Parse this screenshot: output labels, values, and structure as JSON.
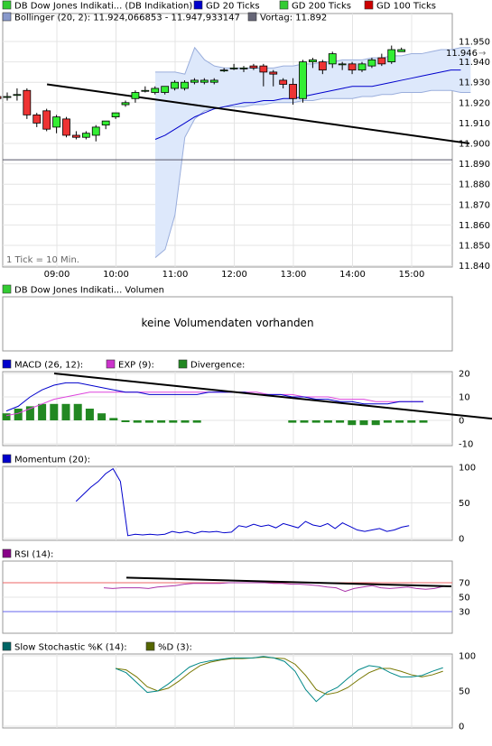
{
  "price_legend": [
    {
      "label": "DB Dow Jones Indikati... (DB Indikation)",
      "color": "#33cc33"
    },
    {
      "label": "GD 20 Ticks",
      "color": "#0000cc"
    },
    {
      "label": "GD 200 Ticks",
      "color": "#33cc33"
    },
    {
      "label": "GD 100 Ticks",
      "color": "#cc0000"
    },
    {
      "label": "Bollinger (20, 2): 11.924,066853 - 11.947,933147",
      "color": "#8899cc"
    },
    {
      "label": "Vortag: 11.892",
      "color": "#666677"
    }
  ],
  "tick_note": "1 Tick = 10 Min.",
  "last_price_label": "11.946",
  "volume": {
    "label": "DB Dow Jones Indikati... Volumen",
    "message": "keine Volumendaten vorhanden"
  },
  "macd_legend": [
    {
      "label": "MACD (26, 12):",
      "color": "#0000cc"
    },
    {
      "label": "EXP (9):",
      "color": "#cc33cc"
    },
    {
      "label": "Divergence:",
      "color": "#228822"
    }
  ],
  "momentum_legend": [
    {
      "label": "Momentum (20):",
      "color": "#0000cc"
    }
  ],
  "rsi_legend": [
    {
      "label": "RSI (14):",
      "color": "#880088"
    }
  ],
  "stoch_legend": [
    {
      "label": "Slow Stochastic %K (14):",
      "color": "#006666"
    },
    {
      "label": "%D (3):",
      "color": "#556600"
    }
  ],
  "chart_data": [
    {
      "type": "candlestick",
      "x_labels": [
        "09:00",
        "10:00",
        "11:00",
        "12:00",
        "13:00",
        "14:00",
        "15:00"
      ],
      "ylim": [
        11835,
        11955
      ],
      "yticks": [
        "11.840",
        "11.850",
        "11.860",
        "11.870",
        "11.880",
        "11.890",
        "11.900",
        "11.910",
        "11.920",
        "11.930",
        "11.940",
        "11.950"
      ],
      "reference_line": 11892,
      "candles": [
        {
          "t": "08:30",
          "o": 11921,
          "h": 11925,
          "l": 11917,
          "c": 11924
        },
        {
          "t": "08:40",
          "o": 11924,
          "h": 11925,
          "l": 11922,
          "c": 11923
        },
        {
          "t": "08:50",
          "o": 11923,
          "h": 11924,
          "l": 11921,
          "c": 11922
        },
        {
          "t": "09:00",
          "o": 11923,
          "h": 11925,
          "l": 11921,
          "c": 11923
        },
        {
          "t": "09:10",
          "o": 11924,
          "h": 11927,
          "l": 11921,
          "c": 11924
        },
        {
          "t": "09:20",
          "o": 11926,
          "h": 11927,
          "l": 11912,
          "c": 11914
        },
        {
          "t": "09:30",
          "o": 11914,
          "h": 11915,
          "l": 11908,
          "c": 11910
        },
        {
          "t": "09:40",
          "o": 11916,
          "h": 11917,
          "l": 11906,
          "c": 11907
        },
        {
          "t": "09:50",
          "o": 11908,
          "h": 11914,
          "l": 11905,
          "c": 11913
        },
        {
          "t": "10:00",
          "o": 11912,
          "h": 11913,
          "l": 11903,
          "c": 11904
        },
        {
          "t": "10:10",
          "o": 11904,
          "h": 11906,
          "l": 11902,
          "c": 11903
        },
        {
          "t": "10:20",
          "o": 11903,
          "h": 11906,
          "l": 11902,
          "c": 11905
        },
        {
          "t": "10:30",
          "o": 11904,
          "h": 11909,
          "l": 11901,
          "c": 11908
        },
        {
          "t": "10:40",
          "o": 11909,
          "h": 11911,
          "l": 11907,
          "c": 11911
        },
        {
          "t": "10:50",
          "o": 11913,
          "h": 11915,
          "l": 11912,
          "c": 11915
        },
        {
          "t": "11:00",
          "o": 11919,
          "h": 11921,
          "l": 11918,
          "c": 11920
        },
        {
          "t": "11:10",
          "o": 11922,
          "h": 11926,
          "l": 11920,
          "c": 11925
        },
        {
          "t": "11:20",
          "o": 11926,
          "h": 11928,
          "l": 11925,
          "c": 11926
        },
        {
          "t": "11:30",
          "o": 11925,
          "h": 11928,
          "l": 11924,
          "c": 11927
        },
        {
          "t": "11:40",
          "o": 11925,
          "h": 11928,
          "l": 11924,
          "c": 11928
        },
        {
          "t": "11:50",
          "o": 11927,
          "h": 11931,
          "l": 11926,
          "c": 11930
        },
        {
          "t": "12:00",
          "o": 11927,
          "h": 11931,
          "l": 11926,
          "c": 11930
        },
        {
          "t": "12:10",
          "o": 11930,
          "h": 11932,
          "l": 11929,
          "c": 11931
        },
        {
          "t": "12:20",
          "o": 11930,
          "h": 11932,
          "l": 11929,
          "c": 11931
        },
        {
          "t": "12:30",
          "o": 11930,
          "h": 11932,
          "l": 11929,
          "c": 11931
        },
        {
          "t": "12:40",
          "o": 11936,
          "h": 11937,
          "l": 11935,
          "c": 11936
        },
        {
          "t": "12:50",
          "o": 11937,
          "h": 11939,
          "l": 11936,
          "c": 11937
        },
        {
          "t": "13:00",
          "o": 11937,
          "h": 11938,
          "l": 11935,
          "c": 11937
        },
        {
          "t": "13:10",
          "o": 11938,
          "h": 11939,
          "l": 11936,
          "c": 11937
        },
        {
          "t": "13:20",
          "o": 11938,
          "h": 11939,
          "l": 11928,
          "c": 11935
        },
        {
          "t": "13:30",
          "o": 11935,
          "h": 11936,
          "l": 11928,
          "c": 11934
        },
        {
          "t": "13:40",
          "o": 11931,
          "h": 11932,
          "l": 11927,
          "c": 11929
        },
        {
          "t": "13:50",
          "o": 11929,
          "h": 11932,
          "l": 11919,
          "c": 11922
        },
        {
          "t": "14:00",
          "o": 11922,
          "h": 11941,
          "l": 11920,
          "c": 11940
        },
        {
          "t": "14:10",
          "o": 11940,
          "h": 11942,
          "l": 11937,
          "c": 11941
        },
        {
          "t": "14:20",
          "o": 11940,
          "h": 11941,
          "l": 11934,
          "c": 11936
        },
        {
          "t": "14:30",
          "o": 11939,
          "h": 11945,
          "l": 11937,
          "c": 11944
        },
        {
          "t": "14:40",
          "o": 11939,
          "h": 11940,
          "l": 11936,
          "c": 11939
        },
        {
          "t": "14:50",
          "o": 11939,
          "h": 11940,
          "l": 11934,
          "c": 11936
        },
        {
          "t": "15:00",
          "o": 11936,
          "h": 11940,
          "l": 11935,
          "c": 11939
        },
        {
          "t": "15:10",
          "o": 11938,
          "h": 11942,
          "l": 11937,
          "c": 11941
        },
        {
          "t": "15:20",
          "o": 11942,
          "h": 11944,
          "l": 11938,
          "c": 11939
        },
        {
          "t": "15:30",
          "o": 11940,
          "h": 11948,
          "l": 11939,
          "c": 11946
        },
        {
          "t": "15:40",
          "o": 11945,
          "h": 11947,
          "l": 11945,
          "c": 11946
        }
      ],
      "gd20": [
        11902,
        11904,
        11907,
        11910,
        11913,
        11915,
        11917,
        11918,
        11919,
        11920,
        11920,
        11921,
        11921,
        11922,
        11922,
        11923,
        11924,
        11925,
        11926,
        11927,
        11928,
        11928,
        11928,
        11929,
        11930,
        11931,
        11932,
        11933,
        11934,
        11935,
        11936,
        11936
      ],
      "bollinger_upper": [
        11935,
        11935,
        11935,
        11934,
        11947,
        11941,
        11938,
        11937,
        11937,
        11937,
        11937,
        11937,
        11937,
        11938,
        11938,
        11939,
        11939,
        11940,
        11940,
        11941,
        11941,
        11941,
        11942,
        11942,
        11943,
        11943,
        11944,
        11944,
        11945,
        11946,
        11946,
        11947,
        11947
      ],
      "bollinger_lower": [
        11844,
        11848,
        11865,
        11903,
        11912,
        11916,
        11917,
        11918,
        11918,
        11918,
        11919,
        11919,
        11920,
        11920,
        11920,
        11921,
        11921,
        11922,
        11922,
        11922,
        11922,
        11923,
        11923,
        11924,
        11924,
        11925,
        11925,
        11925,
        11926,
        11926,
        11926,
        11925,
        11925
      ],
      "trendline": {
        "from": {
          "t": "08:50",
          "v": 11929
        },
        "to": {
          "t": "16:00",
          "v": 11900
        }
      }
    },
    {
      "type": "bar+line",
      "name": "MACD (26, 12)",
      "ylim": [
        -10,
        20
      ],
      "yticks": [
        "20",
        "10",
        "0",
        "-10"
      ],
      "macd": [
        4,
        6,
        10,
        13,
        15,
        16,
        16,
        15,
        14,
        13,
        12,
        12,
        11,
        11,
        11,
        11,
        11,
        12,
        12,
        12,
        12,
        11,
        11,
        11,
        10,
        10,
        9,
        9,
        8,
        8,
        7,
        7,
        7,
        8,
        8,
        8
      ],
      "exp": [
        2,
        3,
        5,
        7,
        9,
        10,
        11,
        12,
        12,
        12,
        12,
        12,
        12,
        12,
        12,
        12,
        12,
        12,
        12,
        12,
        12,
        12,
        11,
        11,
        11,
        10,
        10,
        10,
        9,
        9,
        9,
        8,
        8,
        8,
        8,
        8
      ],
      "divergence": [
        3,
        5,
        6,
        7,
        7,
        7,
        7,
        5,
        3,
        1,
        0,
        -1,
        -1,
        -1,
        -1,
        -1,
        -1,
        null,
        null,
        null,
        null,
        null,
        null,
        null,
        -1,
        -1,
        -1,
        -1,
        -1,
        -2,
        -2,
        -2,
        -1,
        -1,
        -1,
        -1
      ],
      "trendline": {
        "from": -6.5,
        "from_v": 20,
        "to_v": 6.5
      }
    },
    {
      "type": "line",
      "name": "Momentum (20)",
      "ylim": [
        0,
        100
      ],
      "yticks": [
        "100",
        "50",
        "0"
      ],
      "values": [
        null,
        null,
        null,
        null,
        null,
        null,
        null,
        null,
        null,
        null,
        null,
        null,
        null,
        null,
        null,
        null,
        null,
        null,
        null,
        null,
        null,
        null,
        null,
        null,
        null,
        null,
        null,
        null,
        null,
        null,
        null,
        null,
        null,
        null,
        null,
        null,
        52,
        62,
        72,
        80,
        91,
        98,
        80,
        4,
        6,
        5,
        6,
        5,
        6,
        10,
        8,
        10,
        7,
        10,
        9,
        10,
        8,
        9,
        18,
        16,
        20,
        17,
        19,
        15,
        21,
        18,
        15,
        24,
        19,
        17,
        21,
        14,
        22,
        17,
        12,
        10,
        12,
        14,
        10,
        12,
        16,
        18
      ]
    },
    {
      "type": "line",
      "name": "RSI (14)",
      "ylim": [
        0,
        100
      ],
      "yticks": [
        "70",
        "50",
        "30"
      ],
      "levels": [
        70,
        30
      ],
      "values": [
        63,
        62,
        63,
        63,
        63,
        62,
        64,
        65,
        66,
        68,
        69,
        69,
        69,
        69,
        70,
        70,
        70,
        70,
        70,
        69,
        69,
        68,
        68,
        67,
        66,
        64,
        63,
        58,
        62,
        64,
        66,
        63,
        62,
        63,
        64,
        62,
        61,
        62,
        65
      ],
      "trendline": {
        "from_v": 77,
        "to_v": 65
      }
    },
    {
      "type": "line",
      "name": "Slow Stochastic %K (14)",
      "ylim": [
        0,
        100
      ],
      "yticks": [
        "100",
        "50",
        "0"
      ],
      "k": [
        82,
        76,
        62,
        48,
        50,
        60,
        72,
        84,
        90,
        93,
        95,
        97,
        97,
        97,
        99,
        97,
        92,
        78,
        52,
        35,
        48,
        55,
        68,
        80,
        86,
        84,
        76,
        70,
        70,
        72,
        78,
        83
      ],
      "d": [
        82,
        80,
        70,
        56,
        50,
        54,
        64,
        76,
        86,
        91,
        94,
        96,
        96,
        97,
        98,
        97,
        96,
        88,
        72,
        52,
        45,
        48,
        55,
        66,
        76,
        82,
        82,
        78,
        73,
        70,
        73,
        78
      ]
    }
  ]
}
